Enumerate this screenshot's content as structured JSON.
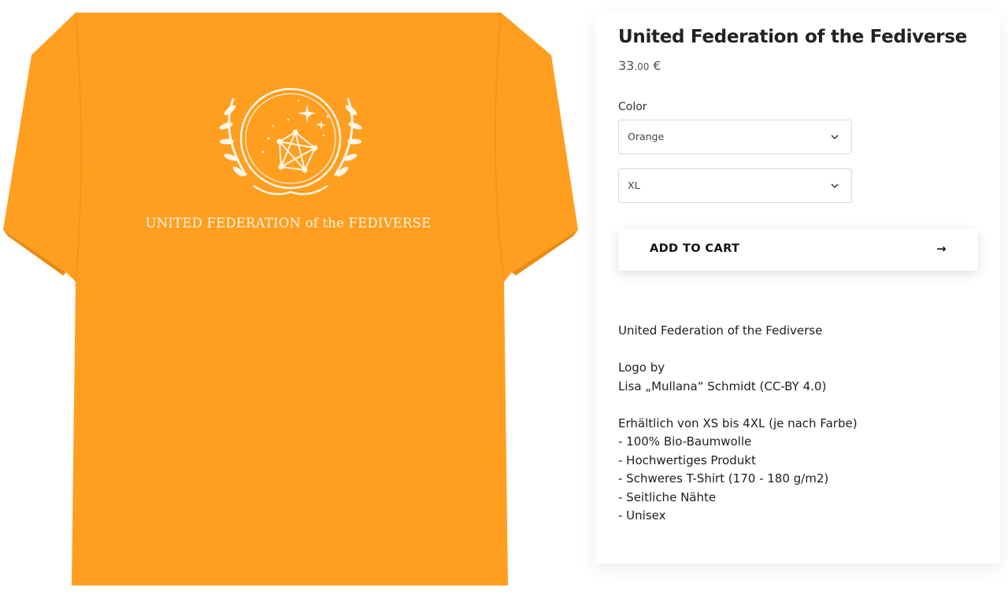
{
  "product": {
    "title": "United Federation of the Fediverse",
    "price_whole": "33",
    "price_decimals": ".00",
    "currency": "€",
    "shirt_print_text": "UNITED FEDERATION of the FEDIVERSE",
    "shirt_color_hex": "#ff9e1f"
  },
  "options": {
    "color_label": "Color",
    "color_value": "Orange",
    "size_value": "XL"
  },
  "cart": {
    "button_label": "ADD TO CART",
    "arrow": "→"
  },
  "description": {
    "heading": "United Federation of the Fediverse",
    "logo_by": "Logo by",
    "logo_author": "Lisa „Mullana“ Schmidt (CC-BY 4.0)",
    "availability": "Erhältlich von XS bis 4XL (je nach Farbe)",
    "features": [
      "- 100% Bio-Baumwolle",
      "- Hochwertiges Produkt",
      "- Schweres T-Shirt (170 - 180 g/m2)",
      "- Seitliche Nähte",
      "- Unisex"
    ]
  },
  "icons": {
    "select_chevron": "chevron-down-icon",
    "cart_arrow": "arrow-right-icon"
  }
}
